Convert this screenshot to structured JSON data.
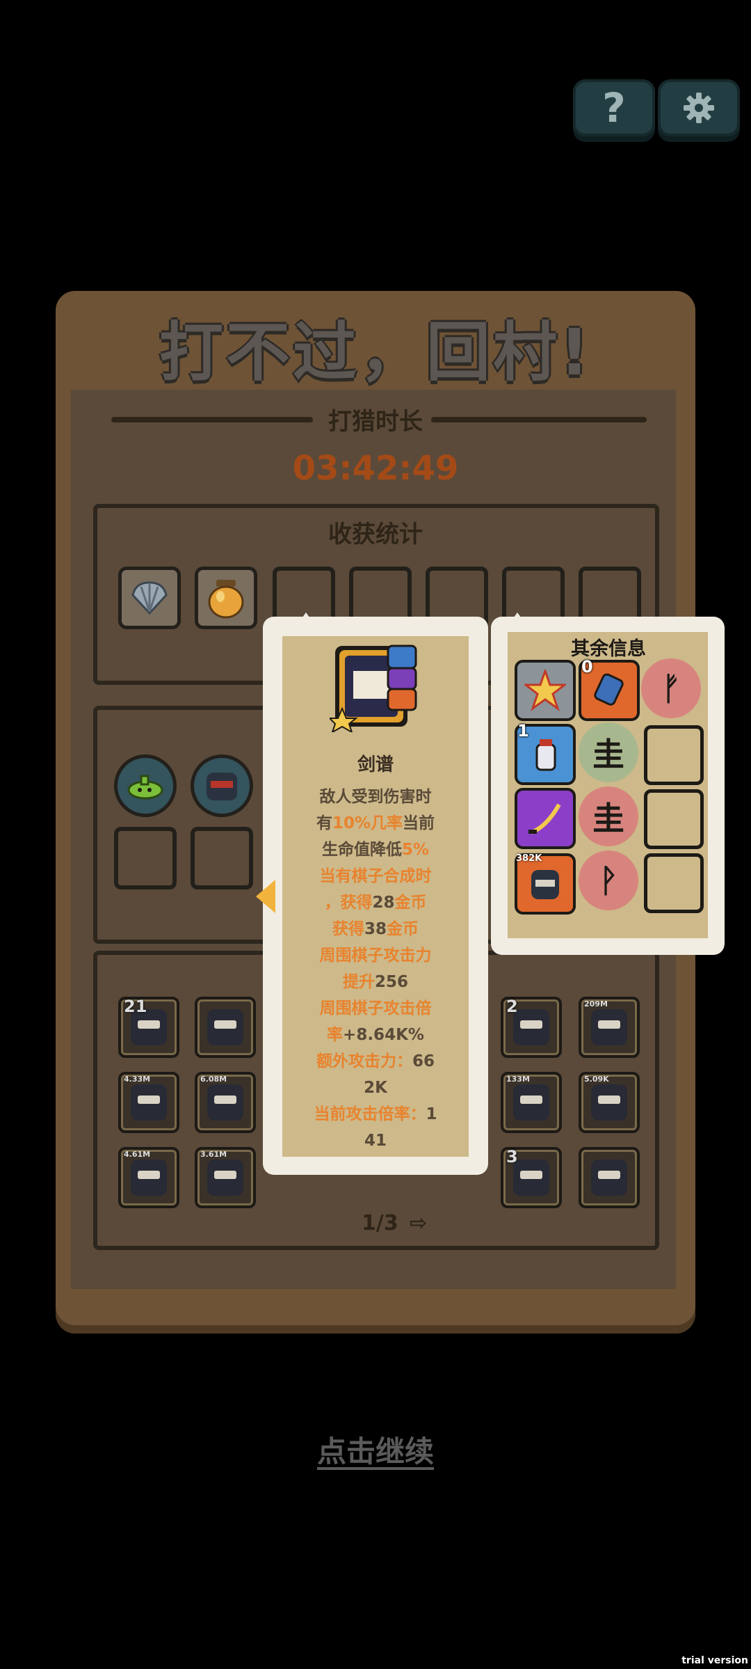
{
  "top_buttons": {
    "help_icon": "?",
    "settings_icon": "gear-icon"
  },
  "panel": {
    "title": "打不过，回村!",
    "hunt_label": "打猎时长",
    "hunt_time": "03:42:49",
    "harvest_title": "收获统计",
    "pager": "1/3"
  },
  "board_pieces": [
    {
      "badge": "21"
    },
    {
      "badge": ""
    },
    {
      "badge": "2"
    },
    {
      "badge": "209M"
    },
    {
      "badge": "4.33M"
    },
    {
      "badge": "6.08M"
    },
    {
      "badge": "133M"
    },
    {
      "badge": "5.09K"
    },
    {
      "badge": "4.61M"
    },
    {
      "badge": "3.61M"
    },
    {
      "badge": "3"
    },
    {
      "badge": ""
    }
  ],
  "tooltip": {
    "name": "剑谱",
    "lines": [
      [
        {
          "t": "敌人受到伤害时"
        }
      ],
      [
        {
          "t": "有"
        },
        {
          "t": "10%几率",
          "hl": true
        },
        {
          "t": "当前"
        }
      ],
      [
        {
          "t": "生命值降低"
        },
        {
          "t": "5%",
          "hl": true
        }
      ],
      [
        {
          "t": "当有棋子合成时",
          "hl": true
        }
      ],
      [
        {
          "t": "，获得",
          "hl": true
        },
        {
          "t": "28"
        },
        {
          "t": "金币",
          "hl": true
        }
      ],
      [
        {
          "t": "获得",
          "hl": true
        },
        {
          "t": "38"
        },
        {
          "t": "金币",
          "hl": true
        }
      ],
      [
        {
          "t": "周围棋子攻击力",
          "hl": true
        }
      ],
      [
        {
          "t": "提升",
          "hl": true
        },
        {
          "t": "256"
        }
      ],
      [
        {
          "t": "周围棋子攻击倍",
          "hl": true
        }
      ],
      [
        {
          "t": "率",
          "hl": true
        },
        {
          "t": "+8.64K%"
        }
      ],
      [
        {
          "t": "额外攻击力：",
          "hl": true
        },
        {
          "t": "66"
        }
      ],
      [
        {
          "t": "2K"
        }
      ],
      [
        {
          "t": "当前攻击倍率：",
          "hl": true
        },
        {
          "t": "1"
        }
      ],
      [
        {
          "t": "41"
        }
      ]
    ]
  },
  "other_info": {
    "title": "其余信息",
    "badges": {
      "hammer": "0",
      "milk": "1",
      "ninja": "382K"
    },
    "runes": [
      "ᚠ",
      "圭",
      "圭",
      "ᚹ"
    ]
  },
  "continue": "点击继续",
  "watermark": "trial version",
  "colors": {
    "accent_orange": "#e8832e",
    "time_color": "#a44a17",
    "panel_brown": "#6e5336"
  }
}
